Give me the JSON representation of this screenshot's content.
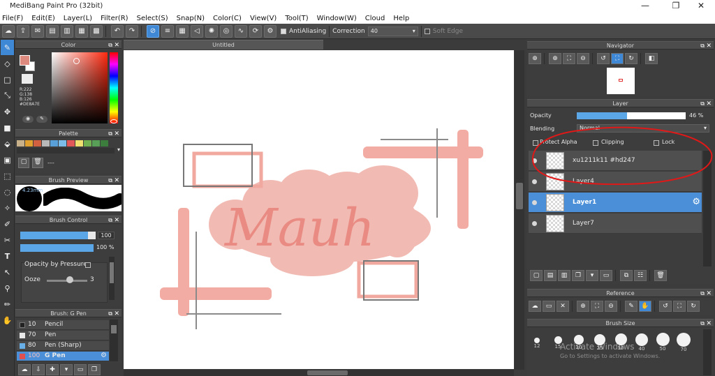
{
  "window": {
    "title": "MediBang Paint Pro (32bit)",
    "minimize": "—",
    "maximize": "❐",
    "close": "✕"
  },
  "menu": [
    "File(F)",
    "Edit(E)",
    "Layer(L)",
    "Filter(R)",
    "Select(S)",
    "Snap(N)",
    "Color(C)",
    "View(V)",
    "Tool(T)",
    "Window(W)",
    "Cloud",
    "Help"
  ],
  "toolbar": {
    "antialiasing_label": "AntiAliasing",
    "correction_label": "Correction",
    "correction_value": "40",
    "soft_edge_label": "Soft Edge"
  },
  "color_panel": {
    "title": "Color",
    "r": "R:222",
    "g": "G:138",
    "b": "B:126",
    "hex": "#DE8A7E",
    "primary_color": "#DE8A7E",
    "secondary_color": "#FFFFFF"
  },
  "palette_panel": {
    "title": "Palette",
    "swatches": [
      "#c8b08a",
      "#e0a030",
      "#d06040",
      "#b8b8b8",
      "#5aa0d8",
      "#7bbce8",
      "#e05858",
      "#f0e070",
      "#70b050",
      "#58a058",
      "#3c7c3c"
    ],
    "entry_label": "---"
  },
  "brush_preview": {
    "title": "Brush Preview",
    "size_label": "4.23mm"
  },
  "brush_control": {
    "title": "Brush Control",
    "size_value": "100",
    "size_fraction": 0.9,
    "opacity_value": "100 %",
    "opacity_fraction": 1.0,
    "opacity_by_pressure": "Opacity by Pressure",
    "ooze_label": "Ooze",
    "ooze_value": "3"
  },
  "brush_list": {
    "title": "Brush: G Pen",
    "items": [
      {
        "size": "10",
        "name": "Pencil",
        "color": "#222222"
      },
      {
        "size": "70",
        "name": "Pen",
        "color": "#e8e8e8"
      },
      {
        "size": "80",
        "name": "Pen (Sharp)",
        "color": "#6ab0e8"
      },
      {
        "size": "100",
        "name": "G Pen",
        "color": "#e05050"
      }
    ]
  },
  "document": {
    "tab": "Untitled",
    "artwork_text": "Mauh"
  },
  "navigator": {
    "title": "Navigator"
  },
  "layer_panel": {
    "title": "Layer",
    "opacity_label": "Opacity",
    "opacity_value": "46 %",
    "opacity_fraction": 0.46,
    "blending_label": "Blending",
    "blending_value": "Normal",
    "protect_alpha": "Protect Alpha",
    "clipping": "Clipping",
    "lock": "Lock",
    "layers": [
      {
        "name": "xu1211k11 #hd247",
        "selected": false
      },
      {
        "name": "Layer4",
        "selected": false
      },
      {
        "name": "Layer1",
        "selected": true
      },
      {
        "name": "Layer7",
        "selected": false
      }
    ]
  },
  "reference_panel": {
    "title": "Reference"
  },
  "brush_size_panel": {
    "title": "Brush Size",
    "sizes": [
      "12",
      "15",
      "20",
      "25",
      "30",
      "40",
      "50",
      "70"
    ],
    "watermark_line1": "Activate Windows",
    "watermark_line2": "Go to Settings to activate Windows."
  }
}
